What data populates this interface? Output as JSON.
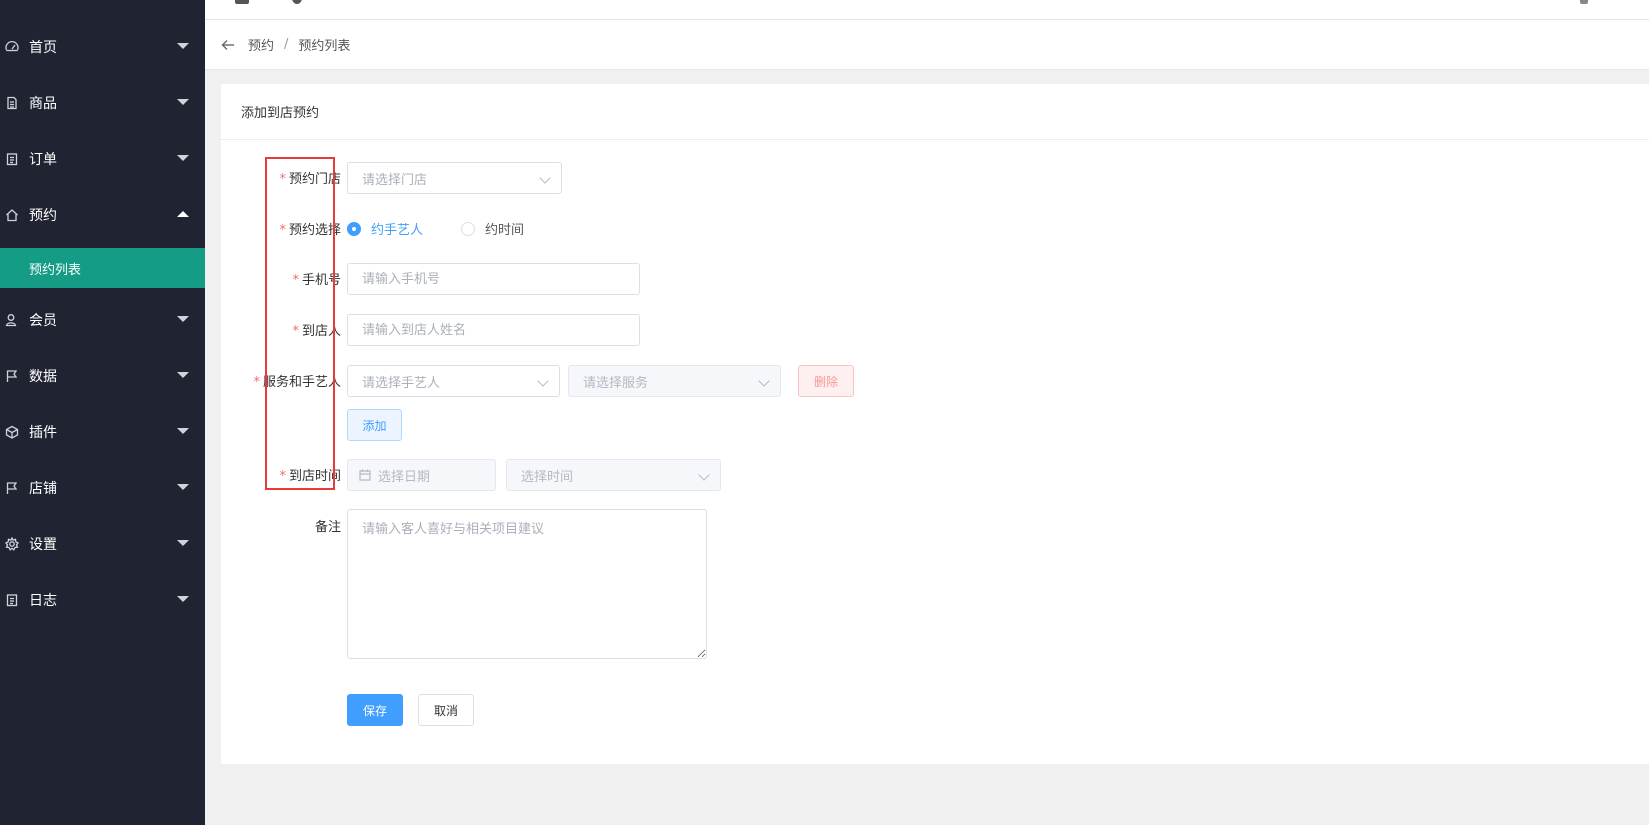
{
  "sidebar": {
    "items": [
      {
        "label": "首页",
        "icon": "dashboard-icon",
        "expanded": false
      },
      {
        "label": "商品",
        "icon": "document-icon",
        "expanded": false
      },
      {
        "label": "订单",
        "icon": "clipboard-icon",
        "expanded": false
      },
      {
        "label": "预约",
        "icon": "home-icon",
        "expanded": true
      },
      {
        "label": "会员",
        "icon": "user-icon",
        "expanded": false
      },
      {
        "label": "数据",
        "icon": "flag-icon",
        "expanded": false
      },
      {
        "label": "插件",
        "icon": "cube-icon",
        "expanded": false
      },
      {
        "label": "店铺",
        "icon": "flag-icon",
        "expanded": false
      },
      {
        "label": "设置",
        "icon": "gear-icon",
        "expanded": false
      },
      {
        "label": "日志",
        "icon": "clipboard-icon",
        "expanded": false
      }
    ],
    "active_sub": "预约列表",
    "accent_color": "#149c86"
  },
  "breadcrumb": {
    "parent": "预约",
    "separator": "/",
    "current": "预约列表"
  },
  "card": {
    "title": "添加到店预约"
  },
  "form": {
    "store": {
      "label": "预约门店",
      "placeholder": "请选择门店",
      "required": true
    },
    "mode": {
      "label": "预约选择",
      "options": [
        "约手艺人",
        "约时间"
      ],
      "selected": "约手艺人",
      "required": true
    },
    "phone": {
      "label": "手机号",
      "placeholder": "请输入手机号",
      "required": true
    },
    "visitor": {
      "label": "到店人",
      "placeholder": "请输入到店人姓名",
      "required": true
    },
    "service": {
      "label": "服务和手艺人",
      "artisan_placeholder": "请选择手艺人",
      "service_placeholder": "请选择服务",
      "delete_label": "删除",
      "add_label": "添加",
      "required": true
    },
    "arrival": {
      "label": "到店时间",
      "date_placeholder": "选择日期",
      "time_placeholder": "选择时间",
      "required": true
    },
    "remark": {
      "label": "备注",
      "placeholder": "请输入客人喜好与相关项目建议"
    },
    "save_label": "保存",
    "cancel_label": "取消"
  },
  "colors": {
    "primary": "#409eff",
    "danger": "#f56c6c",
    "highlight": "#e83a3a"
  }
}
